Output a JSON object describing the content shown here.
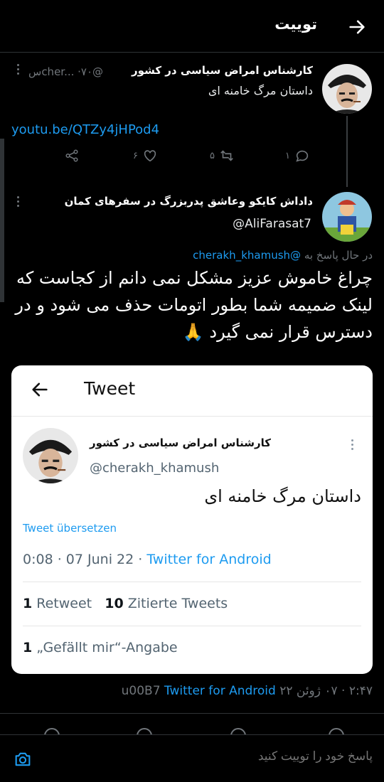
{
  "header": {
    "title": "توییت"
  },
  "tweet1": {
    "name": "کارشناس امراض سیاسی در کشور",
    "handle": "@cher... ·۷۰س",
    "text": "داستان مرگ خامنه ای",
    "link": "youtu.be/QTZy4jHPod4",
    "replies": "۱",
    "retweets": "۵",
    "likes": "۶"
  },
  "tweet2": {
    "name": "داداش کایکو وعاشق پدربزرگ در سفرهای کمان",
    "handle": "@AliFarasat7",
    "reply_prefix": "در حال پاسخ به",
    "reply_handle": "@cherakh_khamush",
    "body": "چراغ خاموش عزیز مشکل نمی دانم از کجاست که لینک ضمیمه شما بطور اتومات حذف می شود و در دسترس قرار نمی گیرد 🙏",
    "meta_time": "۲:۴۷ · ۰۷ ژوئن ۲۲ ",
    "meta_sep": "u00B7 ",
    "meta_client": "Twitter for Android"
  },
  "card": {
    "title": "Tweet",
    "name": "کارشناس امراض سیاسی در کشور",
    "handle": "@cherakh_khamush",
    "text": "داستان مرگ خامنه ای",
    "translate": "Tweet übersetzen",
    "meta_time": "0:08 · 07 Juni 22 · ",
    "meta_client": "Twitter for Android",
    "retweets_count": "1",
    "retweets_label": " Retweet",
    "quotes_count": "10",
    "quotes_label": " Zitierte Tweets",
    "likes_count": "1",
    "likes_label": " „Gefällt mir“-Angabe"
  },
  "composer": {
    "placeholder": "پاسخ خود را توییت کنید"
  },
  "colors": {
    "accent": "#1d9bf0",
    "background": "#000000",
    "muted": "#71767b"
  }
}
